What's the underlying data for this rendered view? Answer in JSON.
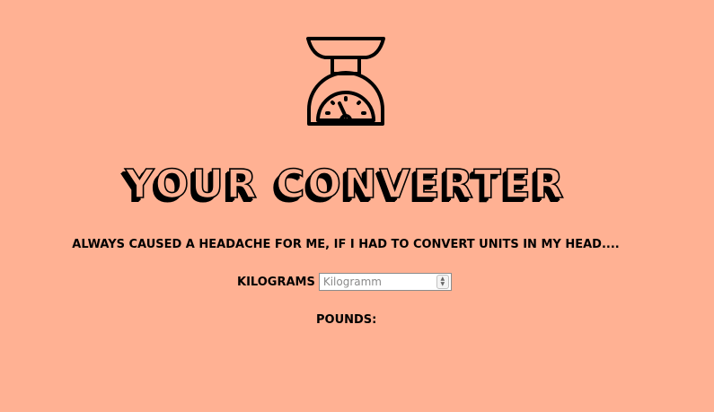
{
  "header": {
    "icon": "kitchen-scale-icon",
    "title": "YOUR CONVERTER",
    "subtitle": "ALWAYS CAUSED A HEADACHE FOR ME, IF I HAD TO CONVERT UNITS IN MY HEAD...."
  },
  "converter": {
    "kg_label": "KILOGRAMS",
    "kg_placeholder": "Kilogramm",
    "kg_value": "",
    "pounds_label": "POUNDS:",
    "pounds_value": ""
  },
  "colors": {
    "background": "#ffb193",
    "ink": "#000000"
  }
}
